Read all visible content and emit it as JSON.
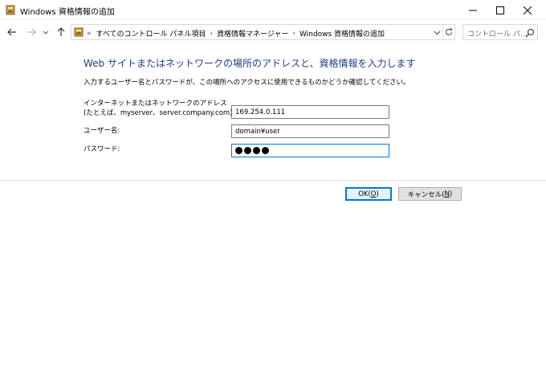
{
  "window": {
    "title": "Windows 資格情報の追加",
    "minimize_glyph": "─",
    "icon": "credential-manager-icon"
  },
  "nav": {
    "back_icon": "arrow-left-icon",
    "forward_icon": "arrow-right-icon",
    "up_icon": "arrow-up-icon",
    "address": {
      "lead": "«",
      "crumbs": [
        "すべてのコントロール パネル項目",
        "資格情報マネージャー",
        "Windows 資格情報の追加"
      ],
      "separator": "›"
    },
    "search_placeholder": "コントロール パ..."
  },
  "form": {
    "heading": "Web サイトまたはネットワークの場所のアドレスと、資格情報を入力します",
    "description": "入力するユーザー名とパスワードが、この場所へのアクセスに使用できるものかどうか確認してください。",
    "address_label_line1": "インターネットまたはネットワークのアドレス",
    "address_label_line2": "(たとえば、myserver、server.company.com):",
    "address_value": "169.254.0.111",
    "username_label": "ユーザー名:",
    "username_value": "domain¥user",
    "password_label": "パスワード:",
    "password_dot_count": 4
  },
  "buttons": {
    "ok_prefix": "OK(",
    "ok_key": "O",
    "ok_suffix": ")",
    "cancel_prefix": "キャンセル(",
    "cancel_key": "N",
    "cancel_suffix": ")"
  },
  "colors": {
    "heading": "#1e3c8c",
    "focus_border": "#0078d7"
  }
}
